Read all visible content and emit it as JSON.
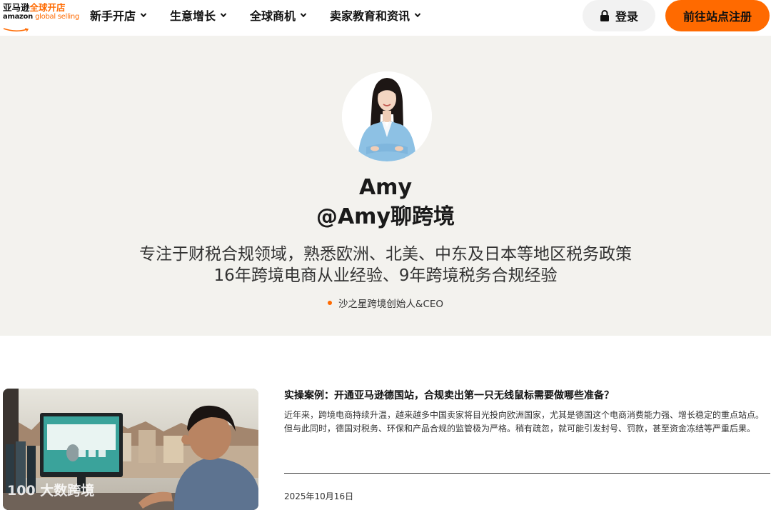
{
  "header": {
    "logo": {
      "cn_part1": "亚马逊",
      "cn_part2": "全球开店",
      "en_part1": "amazon",
      "en_part2": "global selling"
    },
    "nav": [
      {
        "label": "新手开店"
      },
      {
        "label": "生意增长"
      },
      {
        "label": "全球商机"
      },
      {
        "label": "卖家教育和资讯"
      }
    ],
    "login_label": "登录",
    "register_label": "前往站点注册"
  },
  "profile": {
    "name": "Amy",
    "handle": "@Amy聊跨境",
    "bio_line1": "专注于财税合规领域，熟悉欧洲、北美、中东及日本等地区税务政策",
    "bio_line2": "16年跨境电商从业经验、9年跨境税务合规经验",
    "role": "沙之星跨境创始人&CEO"
  },
  "article": {
    "title": "实操案例：开通亚马逊德国站，合规卖出第一只无线鼠标需要做哪些准备？",
    "excerpt": "近年来，跨境电商持续升温，越来越多中国卖家将目光投向欧洲国家，尤其是德国这个电商消费能力强、增长稳定的重点站点。但与此同时，德国对税务、环保和产品合规的监管极为严格。稍有疏忽，就可能引发封号、罚款，甚至资金冻结等严重后果。",
    "date": "2025年10月16日",
    "watermark": "100 大数跨境"
  },
  "colors": {
    "accent": "#ff6a00",
    "hero_bg": "#f3f2ee",
    "login_bg": "#f2f2f2"
  }
}
